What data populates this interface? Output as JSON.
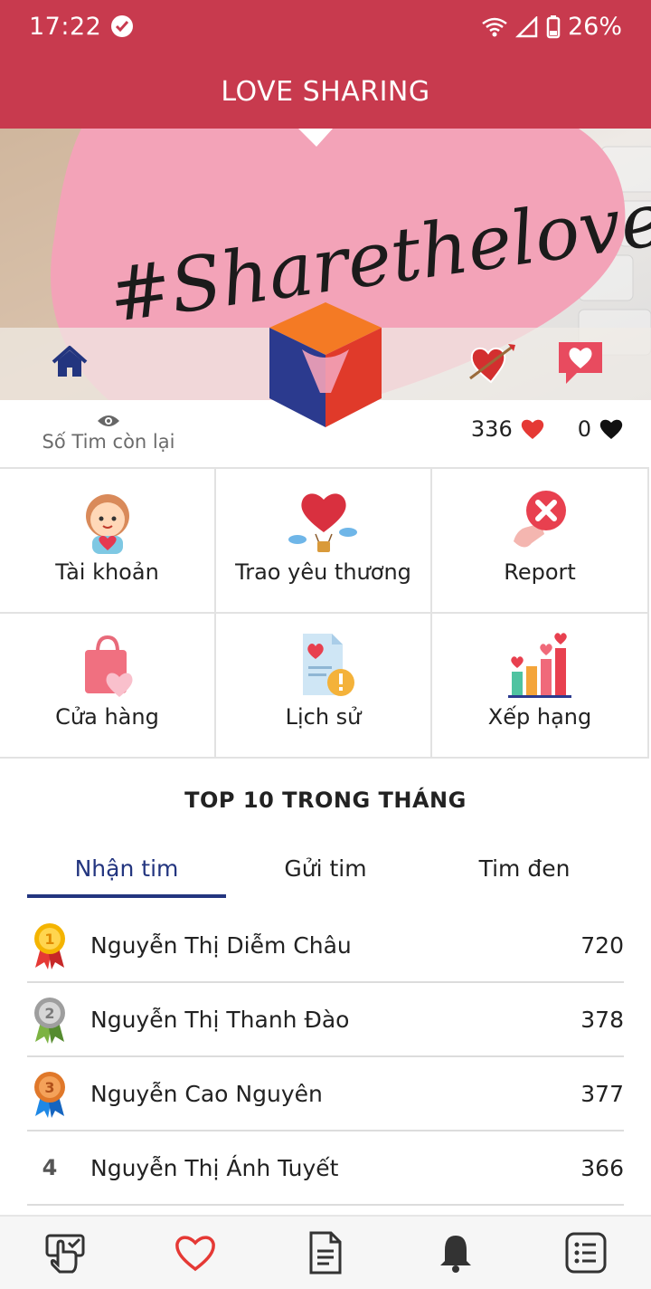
{
  "status": {
    "time": "17:22",
    "battery": "26%"
  },
  "app": {
    "title": "LOVE SHARING"
  },
  "banner": {
    "text": "#Sharethelove"
  },
  "hearts": {
    "remaining_label": "Số Tim còn lại",
    "red_count": "336",
    "black_count": "0"
  },
  "menu": [
    {
      "label": "Tài khoản"
    },
    {
      "label": "Trao yêu thương"
    },
    {
      "label": "Report"
    },
    {
      "label": "Cửa hàng"
    },
    {
      "label": "Lịch sử"
    },
    {
      "label": "Xếp hạng"
    }
  ],
  "leaderboard": {
    "title": "TOP 10 TRONG THÁNG",
    "tabs": [
      "Nhận tim",
      "Gửi tim",
      "Tim đen"
    ],
    "active_tab": "Nhận tim",
    "rows": [
      {
        "rank": "1",
        "name": "Nguyễn Thị Diễm Châu",
        "score": "720"
      },
      {
        "rank": "2",
        "name": "Nguyễn Thị Thanh Đào",
        "score": "378"
      },
      {
        "rank": "3",
        "name": "Nguyễn Cao Nguyên",
        "score": "377"
      },
      {
        "rank": "4",
        "name": "Nguyễn Thị Ánh Tuyết",
        "score": "366"
      }
    ]
  },
  "colors": {
    "brand": "#c83a4e",
    "accent": "#23357f",
    "heart": "#e53935"
  },
  "icons": {
    "bottom_nav": [
      "touch-check-icon",
      "heart-icon",
      "document-icon",
      "bell-icon",
      "list-icon"
    ]
  }
}
